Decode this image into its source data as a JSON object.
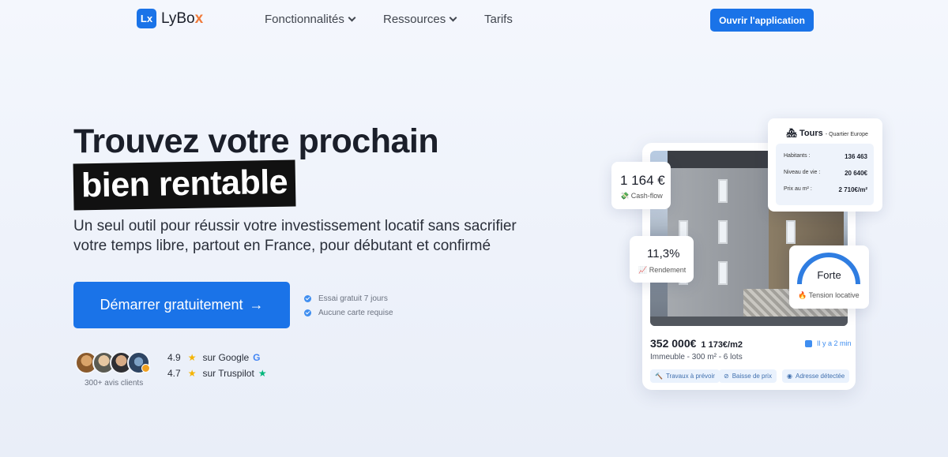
{
  "nav": {
    "logo_icon": "Lx",
    "logo_text": "LyBo",
    "logo_text_x": "x",
    "items": [
      {
        "label": "Fonctionnalités",
        "has_dropdown": true
      },
      {
        "label": "Ressources",
        "has_dropdown": true
      },
      {
        "label": "Tarifs",
        "has_dropdown": false
      }
    ],
    "cta_label": "Ouvrir l'application"
  },
  "hero": {
    "title_line1": "Trouvez votre prochain",
    "title_line2": "bien rentable",
    "subtitle": "Un seul outil pour réussir votre investissement locatif sans sacrifier votre temps libre, partout en France, pour débutant et confirmé",
    "cta_label": "Démarrer gratuitement",
    "cta_arrow": "→",
    "checks": [
      "Essai gratuit 7 jours",
      "Aucune carte requise"
    ]
  },
  "social_proof": {
    "caption": "300+ avis clients",
    "ratings": [
      {
        "score": "4.9",
        "source": "sur Google",
        "icon": "G"
      },
      {
        "score": "4.7",
        "source": "sur Truspilot",
        "icon": "★"
      }
    ]
  },
  "visual": {
    "cashflow": {
      "value": "1 164 €",
      "label": "Cash-flow",
      "emoji": "💸"
    },
    "rendement": {
      "value": "11,3%",
      "label": "Rendement",
      "emoji": "📈"
    },
    "tours": {
      "emoji": "🏘",
      "city": "Tours",
      "district": "- Quartier Europe",
      "rows": [
        {
          "label": "Habitants :",
          "value": "136 463"
        },
        {
          "label": "Niveau de vie :",
          "value": "20 640€"
        },
        {
          "label": "Prix au m² :",
          "value": "2 710€/m²"
        }
      ]
    },
    "tension": {
      "value": "Forte",
      "label": "Tension locative",
      "emoji": "🔥"
    },
    "listing": {
      "price": "352 000€",
      "price_m2": "1 173€/m2",
      "posted": "Il y a 2 min",
      "desc": "Immeuble - 300 m² - 6 lots",
      "tags": [
        {
          "icon": "🔨",
          "label": "Travaux à prévoir"
        },
        {
          "icon": "⊘",
          "label": "Baisse de prix"
        },
        {
          "icon": "◉",
          "label": "Adresse détectée"
        }
      ]
    }
  }
}
